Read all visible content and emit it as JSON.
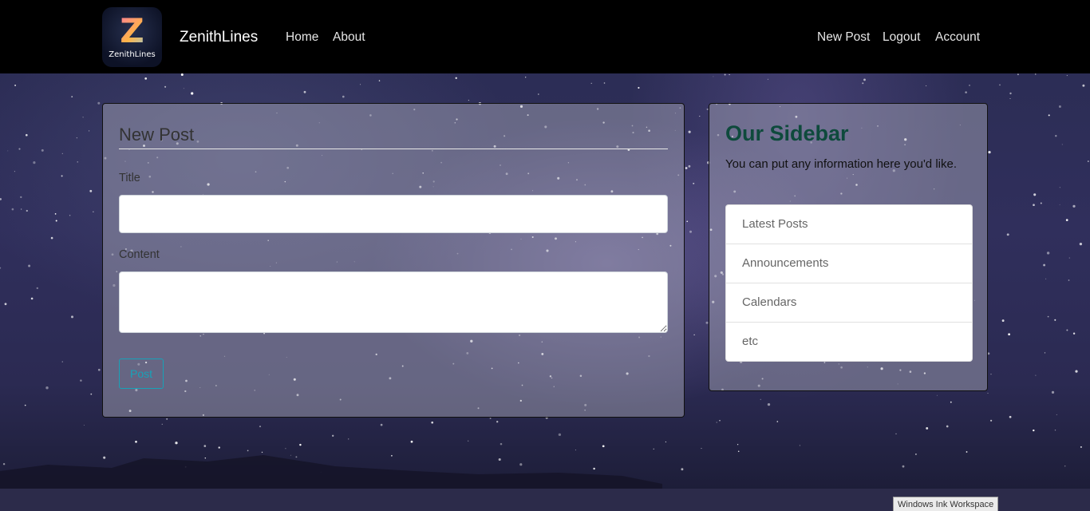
{
  "navbar": {
    "logo_text": "ZenithLines",
    "logo_letter": "Z",
    "brand": "ZenithLines",
    "left_links": [
      "Home",
      "About"
    ],
    "right_links": [
      "New Post",
      "Logout",
      "Account"
    ]
  },
  "post_form": {
    "legend": "New Post",
    "title_label": "Title",
    "title_value": "",
    "content_label": "Content",
    "content_value": "",
    "submit_label": "Post"
  },
  "sidebar": {
    "title": "Our Sidebar",
    "text": "You can put any information here you'd like.",
    "items": [
      "Latest Posts",
      "Announcements",
      "Calendars",
      "etc"
    ]
  },
  "tooltip": {
    "text": "Windows Ink Workspace"
  },
  "colors": {
    "navbar_bg": "#000000",
    "sidebar_title": "#0e4a3c",
    "button_outline": "#17a2b8"
  }
}
